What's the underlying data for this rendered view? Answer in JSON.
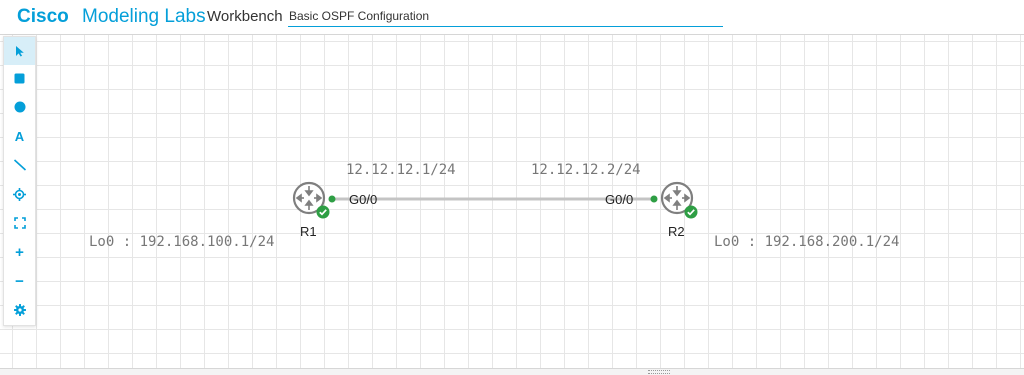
{
  "app": {
    "brand_strong": "Cisco",
    "brand_rest": "Modeling Labs",
    "section": "Workbench",
    "lab_title": "Basic OSPF Configuration"
  },
  "toolbar": {
    "items": [
      {
        "name": "select",
        "icon": "pointer-icon",
        "active": true
      },
      {
        "name": "rectangle",
        "icon": "square-icon"
      },
      {
        "name": "ellipse",
        "icon": "circle-icon"
      },
      {
        "name": "text",
        "icon": "text-icon",
        "glyph": "A"
      },
      {
        "name": "line",
        "icon": "line-icon"
      },
      {
        "name": "center",
        "icon": "crosshair-icon"
      },
      {
        "name": "fit",
        "icon": "fit-screen-icon"
      },
      {
        "name": "zoom-in",
        "icon": "plus-icon",
        "glyph": "+"
      },
      {
        "name": "zoom-out",
        "icon": "minus-icon",
        "glyph": "−"
      },
      {
        "name": "settings",
        "icon": "gear-icon"
      }
    ]
  },
  "topology": {
    "nodes": [
      {
        "name": "R1",
        "icon": "router-icon",
        "status": "running"
      },
      {
        "name": "R2",
        "icon": "router-icon",
        "status": "running"
      }
    ],
    "link": {
      "from": "R1",
      "to": "R2",
      "r1_interface": "G0/0",
      "r2_interface": "G0/0"
    },
    "annotations": {
      "r1_ip": "12.12.12.1/24",
      "r2_ip": "12.12.12.2/24",
      "r1_loopback": "Lo0 : 192.168.100.1/24",
      "r2_loopback": "Lo0 : 192.168.200.1/24"
    }
  },
  "colors": {
    "accent": "#049fd9",
    "link": "#c2c2c2",
    "status_ok": "#2e9e44",
    "router": "#7f7f7f"
  }
}
